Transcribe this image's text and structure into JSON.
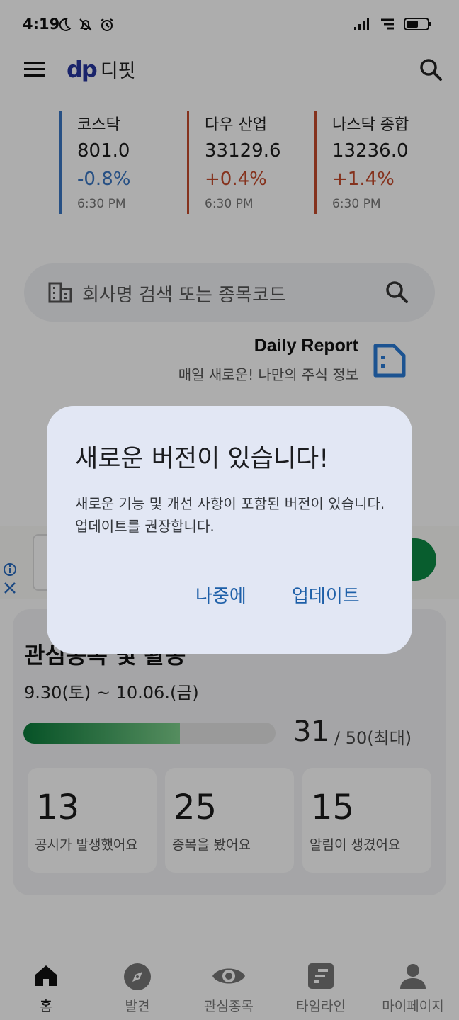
{
  "status_bar": {
    "time": "4:19",
    "icons_left": [
      "moon-icon",
      "bell-off-icon",
      "alarm-icon"
    ],
    "icons_right": [
      "signal-icon",
      "wifi-icon",
      "battery-icon"
    ]
  },
  "app_bar": {
    "logo_mark": "dp",
    "app_name": "디핏",
    "brand_color": "#27359e"
  },
  "indices": [
    {
      "name": "코스닥",
      "value": "801.0",
      "change": "-0.8%",
      "time": "6:30 PM",
      "trend": "down"
    },
    {
      "name": "다우 산업",
      "value": "33129.6",
      "change": "+0.4%",
      "time": "6:30 PM",
      "trend": "up"
    },
    {
      "name": "나스닥 종합",
      "value": "13236.0",
      "change": "+1.4%",
      "time": "6:30 PM",
      "trend": "up"
    }
  ],
  "search": {
    "placeholder": "회사명 검색 또는 종목코드"
  },
  "daily_report": {
    "title": "Daily Report",
    "subtitle": "매일 새로운!  나만의 주식 정보"
  },
  "ad": {
    "info_icon": "info-icon",
    "close_icon": "close-icon"
  },
  "watchlist": {
    "heading": "관심종목 및 활동",
    "dates": "9.30(토) ~ 10.06.(금)",
    "progress_count": "31",
    "progress_max": "/ 50(최대)",
    "progress_fraction": 0.62,
    "stats": [
      {
        "num": "13",
        "label": "공시가 발생했어요"
      },
      {
        "num": "25",
        "label": "종목을 봤어요"
      },
      {
        "num": "15",
        "label": "알림이 생겼어요"
      }
    ]
  },
  "bottom_nav": [
    {
      "label": "홈",
      "icon": "home-icon",
      "active": true
    },
    {
      "label": "발견",
      "icon": "compass-icon",
      "active": false
    },
    {
      "label": "관심종목",
      "icon": "eye-icon",
      "active": false
    },
    {
      "label": "타임라인",
      "icon": "timeline-icon",
      "active": false
    },
    {
      "label": "마이페이지",
      "icon": "person-icon",
      "active": false
    }
  ],
  "dialog": {
    "title": "새로운 버전이 있습니다!",
    "body": "새로운 기능 및 개선 사항이 포함된 버전이 있습니다. 업데이트를 권장합니다.",
    "later_label": "나중에",
    "update_label": "업데이트"
  }
}
